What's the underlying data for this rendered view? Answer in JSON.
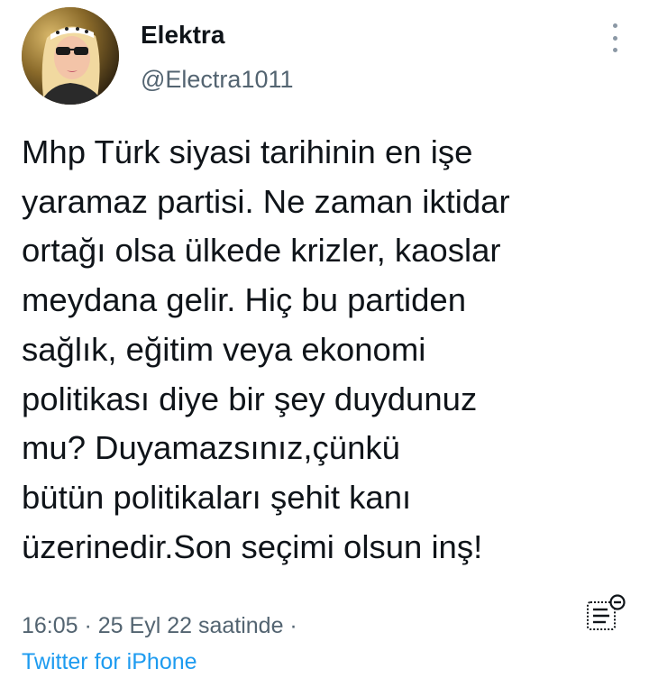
{
  "author": {
    "display_name": "Elektra",
    "handle": "@Electra1011"
  },
  "tweet": {
    "text": "Mhp Türk siyasi tarihinin en işe\nyaramaz partisi. Ne zaman iktidar\nortağı olsa ülkede krizler, kaoslar\nmeydana gelir. Hiç bu partiden\nsağlık, eğitim veya ekonomi\npolitikası diye bir şey duydunuz\nmu? Duyamazsınız,çünkü\nbütün politikaları şehit kanı\nüzerinedir.Son seçimi olsun inş!"
  },
  "meta": {
    "time": "16:05",
    "separator": " · ",
    "date": "25 Eyl 22 saatinde",
    "trailing_separator": " ·",
    "source": "Twitter for iPhone"
  },
  "icons": {
    "more": "more-vertical-icon",
    "notes": "birdwatch-notes-icon",
    "avatar": "profile-photo"
  },
  "colors": {
    "text": "#0f1419",
    "secondary": "#536471",
    "link": "#1d9bf0"
  }
}
